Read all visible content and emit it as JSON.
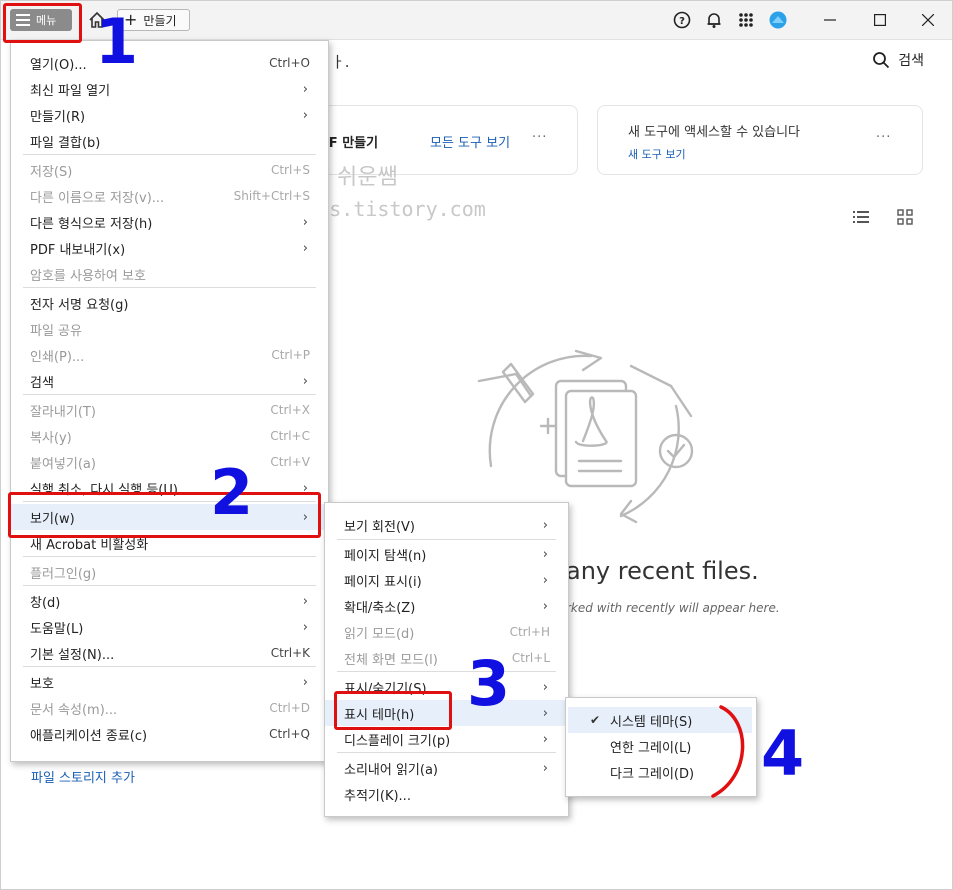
{
  "titlebar": {
    "menu_label": "메뉴",
    "create_label": "만들기",
    "icons": [
      "hamburger-icon",
      "home-icon",
      "plus-icon",
      "help-icon",
      "bell-icon",
      "apps-grid-icon",
      "cloud-avatar-icon",
      "minimize-icon",
      "maximize-icon",
      "close-icon"
    ]
  },
  "header": {
    "search_label": "검색",
    "partial_text": "ㅏ."
  },
  "cards": {
    "tools_partial_title": "DF 만들기",
    "tools_link": "모든 도구 보기",
    "new_tools_title": "새 도구에 액세스할 수 있습니다",
    "new_tools_link": "새 도구 보기"
  },
  "watermark": {
    "line1": "쉬운쌤",
    "line2": "tervors.tistory.com"
  },
  "empty_state": {
    "title": "any recent files.",
    "subtitle": "rked with recently will appear here."
  },
  "storage_link": "파일 스토리지 추가",
  "main_menu": {
    "items": [
      {
        "label": "열기(O)...",
        "shortcut": "Ctrl+O",
        "disabled": false,
        "submenu": false
      },
      {
        "label": "최신 파일 열기",
        "shortcut": "",
        "disabled": false,
        "submenu": true
      },
      {
        "label": "만들기(R)",
        "shortcut": "",
        "disabled": false,
        "submenu": true
      },
      {
        "label": "파일 결합(b)",
        "shortcut": "",
        "disabled": false,
        "submenu": false
      },
      {
        "label": "저장(S)",
        "shortcut": "Ctrl+S",
        "disabled": true,
        "submenu": false
      },
      {
        "label": "다른 이름으로 저장(v)...",
        "shortcut": "Shift+Ctrl+S",
        "disabled": true,
        "submenu": false
      },
      {
        "label": "다른 형식으로 저장(h)",
        "shortcut": "",
        "disabled": false,
        "submenu": true
      },
      {
        "label": "PDF 내보내기(x)",
        "shortcut": "",
        "disabled": false,
        "submenu": true
      },
      {
        "label": "암호를 사용하여 보호",
        "shortcut": "",
        "disabled": true,
        "submenu": false
      },
      {
        "label": "전자 서명 요청(g)",
        "shortcut": "",
        "disabled": false,
        "submenu": false
      },
      {
        "label": "파일 공유",
        "shortcut": "",
        "disabled": true,
        "submenu": false
      },
      {
        "label": "인쇄(P)...",
        "shortcut": "Ctrl+P",
        "disabled": true,
        "submenu": false
      },
      {
        "label": "검색",
        "shortcut": "",
        "disabled": false,
        "submenu": true
      },
      {
        "label": "잘라내기(T)",
        "shortcut": "Ctrl+X",
        "disabled": true,
        "submenu": false
      },
      {
        "label": "복사(y)",
        "shortcut": "Ctrl+C",
        "disabled": true,
        "submenu": false
      },
      {
        "label": "붙여넣기(a)",
        "shortcut": "Ctrl+V",
        "disabled": true,
        "submenu": false
      },
      {
        "label": "실행 취소, 다시 실행 등(U)",
        "shortcut": "",
        "disabled": false,
        "submenu": true
      },
      {
        "label": "보기(w)",
        "shortcut": "",
        "disabled": false,
        "submenu": true
      },
      {
        "label": "새 Acrobat 비활성화",
        "shortcut": "",
        "disabled": false,
        "submenu": false
      },
      {
        "label": "플러그인(g)",
        "shortcut": "",
        "disabled": true,
        "submenu": false
      },
      {
        "label": "창(d)",
        "shortcut": "",
        "disabled": false,
        "submenu": true
      },
      {
        "label": "도움말(L)",
        "shortcut": "",
        "disabled": false,
        "submenu": true
      },
      {
        "label": "기본 설정(N)...",
        "shortcut": "Ctrl+K",
        "disabled": false,
        "submenu": false
      },
      {
        "label": "보호",
        "shortcut": "",
        "disabled": false,
        "submenu": true
      },
      {
        "label": "문서 속성(m)...",
        "shortcut": "Ctrl+D",
        "disabled": true,
        "submenu": false
      },
      {
        "label": "애플리케이션 종료(c)",
        "shortcut": "Ctrl+Q",
        "disabled": false,
        "submenu": false
      }
    ]
  },
  "view_menu": {
    "items": [
      {
        "label": "보기 회전(V)",
        "shortcut": "",
        "disabled": false,
        "submenu": true
      },
      {
        "label": "페이지 탐색(n)",
        "shortcut": "",
        "disabled": false,
        "submenu": true
      },
      {
        "label": "페이지 표시(i)",
        "shortcut": "",
        "disabled": false,
        "submenu": true
      },
      {
        "label": "확대/축소(Z)",
        "shortcut": "",
        "disabled": false,
        "submenu": true
      },
      {
        "label": "읽기 모드(d)",
        "shortcut": "Ctrl+H",
        "disabled": true,
        "submenu": false
      },
      {
        "label": "전체 화면 모드(l)",
        "shortcut": "Ctrl+L",
        "disabled": true,
        "submenu": false
      },
      {
        "label": "표시/숨기기(S)",
        "shortcut": "",
        "disabled": false,
        "submenu": true
      },
      {
        "label": "표시 테마(h)",
        "shortcut": "",
        "disabled": false,
        "submenu": true
      },
      {
        "label": "디스플레이 크기(p)",
        "shortcut": "",
        "disabled": false,
        "submenu": true
      },
      {
        "label": "소리내어 읽기(a)",
        "shortcut": "",
        "disabled": false,
        "submenu": true
      },
      {
        "label": "추적기(K)...",
        "shortcut": "",
        "disabled": false,
        "submenu": false
      }
    ]
  },
  "theme_menu": {
    "items": [
      {
        "label": "시스템 테마(S)",
        "checked": true
      },
      {
        "label": "연한 그레이(L)",
        "checked": false
      },
      {
        "label": "다크 그레이(D)",
        "checked": false
      }
    ],
    "check_glyph": "✔"
  },
  "annotations": {
    "n1": "1",
    "n2": "2",
    "n3": "3",
    "n4": "4",
    "color_box": "#e01010",
    "color_num": "#1010e0"
  }
}
